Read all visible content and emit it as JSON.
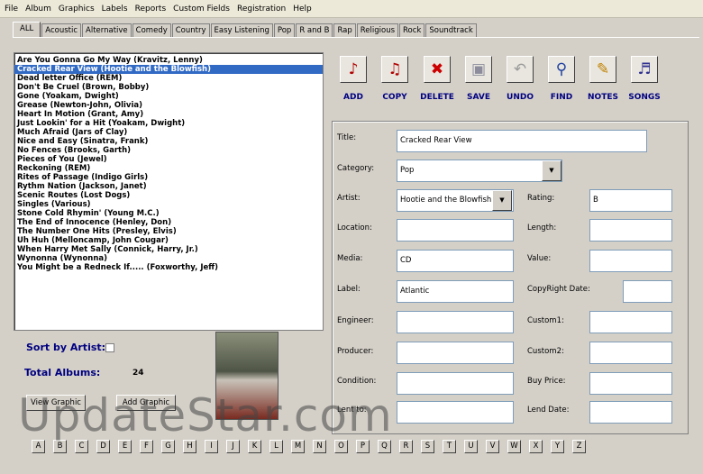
{
  "menu": [
    "File",
    "Album",
    "Graphics",
    "Labels",
    "Reports",
    "Custom Fields",
    "Registration",
    "Help"
  ],
  "tabs": [
    "ALL",
    "Acoustic",
    "Alternative",
    "Comedy",
    "Country",
    "Easy Listening",
    "Pop",
    "R and B",
    "Rap",
    "Religious",
    "Rock",
    "Soundtrack"
  ],
  "albums": [
    "Are You Gonna Go My Way (Kravitz, Lenny)",
    "Cracked Rear View (Hootie and the Blowfish)",
    "Dead letter Office (REM)",
    "Don't Be Cruel (Brown, Bobby)",
    "Gone (Yoakam, Dwight)",
    "Grease (Newton-John, Olivia)",
    "Heart In Motion (Grant, Amy)",
    "Just Lookin' for a Hit (Yoakam, Dwight)",
    "Much Afraid (Jars of Clay)",
    "Nice and Easy (Sinatra, Frank)",
    "No Fences (Brooks, Garth)",
    "Pieces of You (Jewel)",
    "Reckoning (REM)",
    "Rites of Passage (Indigo Girls)",
    "Rythm Nation (Jackson, Janet)",
    "Scenic Routes (Lost Dogs)",
    "Singles (Various)",
    "Stone Cold Rhymin' (Young M.C.)",
    "The End of Innocence (Henley, Don)",
    "The Number One Hits (Presley, Elvis)",
    "Uh Huh (Melloncamp, John Cougar)",
    "When Harry Met Sally (Connick, Harry, Jr.)",
    "Wynonna (Wynonna)",
    "You Might be a Redneck If..... (Foxworthy, Jeff)"
  ],
  "selected_album": "Cracked Rear View (Hootie and the Blowfish)",
  "toolbar": {
    "add": "ADD",
    "copy": "COPY",
    "delete": "DELETE",
    "save": "SAVE",
    "undo": "UNDO",
    "find": "FIND",
    "notes": "NOTES",
    "songs": "SONGS"
  },
  "form": {
    "title_label": "Title:",
    "title_value": "Cracked Rear View",
    "category_label": "Category:",
    "category_value": "Pop",
    "artist_label": "Artist:",
    "artist_value": "Hootie and the Blowfish",
    "rating_label": "Rating:",
    "rating_value": "B",
    "location_label": "Location:",
    "location_value": "",
    "length_label": "Length:",
    "length_value": "",
    "media_label": "Media:",
    "media_value": "CD",
    "value_label": "Value:",
    "value_value": "",
    "label_label": "Label:",
    "label_value": "Atlantic",
    "copyright_label": "CopyRight Date:",
    "copyright_value": "",
    "engineer_label": "Engineer:",
    "engineer_value": "",
    "custom1_label": "Custom1:",
    "custom1_value": "",
    "producer_label": "Producer:",
    "producer_value": "",
    "custom2_label": "Custom2:",
    "custom2_value": "",
    "condition_label": "Condition:",
    "condition_value": "",
    "buyprice_label": "Buy Price:",
    "buyprice_value": "",
    "lentto_label": "Lent to:",
    "lentto_value": "",
    "lenddate_label": "Lend Date:",
    "lenddate_value": ""
  },
  "bottom": {
    "sort_label": "Sort by Artist:",
    "total_label": "Total Albums:",
    "total_value": "24",
    "view_graphic": "View Graphic",
    "add_graphic": "Add Graphic"
  },
  "letters": [
    "A",
    "B",
    "C",
    "D",
    "E",
    "F",
    "G",
    "H",
    "I",
    "J",
    "K",
    "L",
    "M",
    "N",
    "O",
    "P",
    "Q",
    "R",
    "S",
    "T",
    "U",
    "V",
    "W",
    "X",
    "Y",
    "Z"
  ],
  "watermark": "UpdateStar.com",
  "icons": {
    "add": "♪",
    "copy": "♫",
    "delete": "✖",
    "save": "▣",
    "undo": "↶",
    "find": "⚲",
    "notes": "✎",
    "songs": "♬"
  },
  "colors": {
    "selection": "#316ac5",
    "toolbar_label": "#000080",
    "delete_icon": "#cc0000",
    "note_icon": "#b00000"
  }
}
